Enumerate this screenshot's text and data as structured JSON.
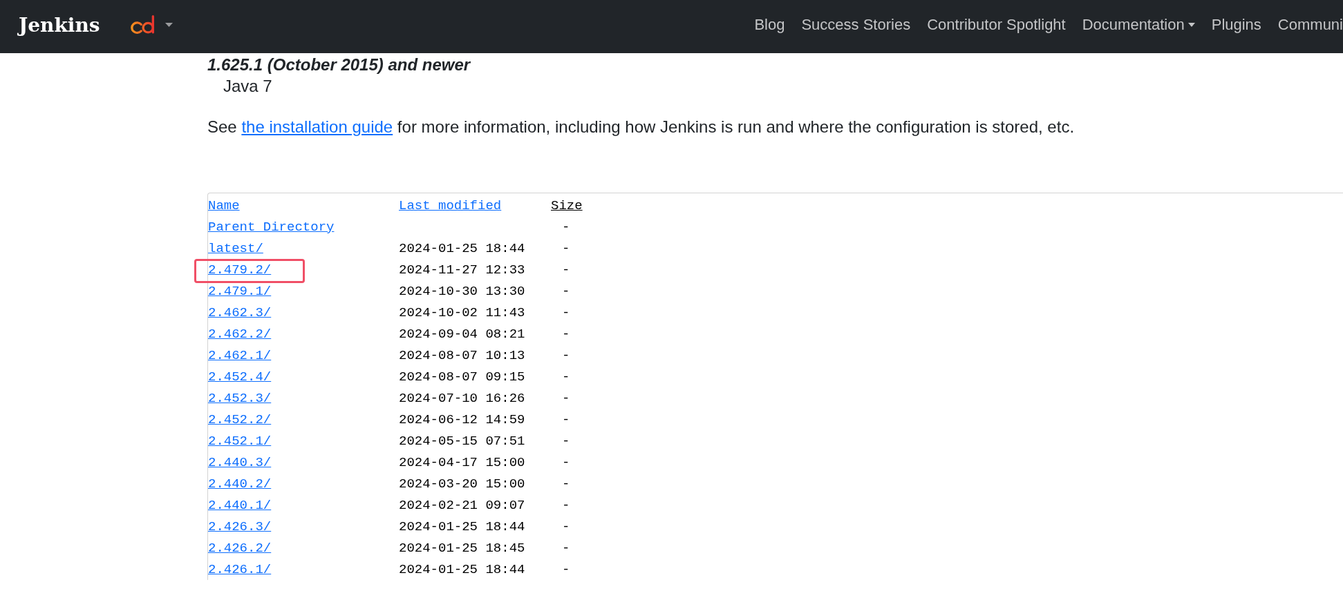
{
  "header": {
    "brand": "Jenkins",
    "nav": [
      {
        "label": "Blog",
        "dropdown": false
      },
      {
        "label": "Success Stories",
        "dropdown": false
      },
      {
        "label": "Contributor Spotlight",
        "dropdown": false
      },
      {
        "label": "Documentation",
        "dropdown": true
      },
      {
        "label": "Plugins",
        "dropdown": false
      },
      {
        "label": "Communi",
        "dropdown": false
      }
    ]
  },
  "requirements": [
    {
      "version": "1.625.1 (October 2015) and newer",
      "java": "Java 7"
    }
  ],
  "install_note": {
    "before": "See ",
    "link": "the installation guide",
    "after": " for more information, including how Jenkins is run and where the configuration is stored, etc."
  },
  "listing": {
    "columns": [
      "Name",
      "Last modified",
      "Size"
    ],
    "rows": [
      {
        "name": "Parent Directory",
        "size": "-",
        "highlighted": false
      },
      {
        "name": "latest/",
        "modified": "2024-01-25 18:44",
        "size": "-",
        "highlighted": false
      },
      {
        "name": "2.479.2/",
        "modified": "2024-11-27 12:33",
        "size": "-",
        "highlighted": true
      },
      {
        "name": "2.479.1/",
        "modified": "2024-10-30 13:30",
        "size": "-",
        "highlighted": false
      },
      {
        "name": "2.462.3/",
        "modified": "2024-10-02 11:43",
        "size": "-",
        "highlighted": false
      },
      {
        "name": "2.462.2/",
        "modified": "2024-09-04 08:21",
        "size": "-",
        "highlighted": false
      },
      {
        "name": "2.462.1/",
        "modified": "2024-08-07 10:13",
        "size": "-",
        "highlighted": false
      },
      {
        "name": "2.452.4/",
        "modified": "2024-08-07 09:15",
        "size": "-",
        "highlighted": false
      },
      {
        "name": "2.452.3/",
        "modified": "2024-07-10 16:26",
        "size": "-",
        "highlighted": false
      },
      {
        "name": "2.452.2/",
        "modified": "2024-06-12 14:59",
        "size": "-",
        "highlighted": false
      },
      {
        "name": "2.452.1/",
        "modified": "2024-05-15 07:51",
        "size": "-",
        "highlighted": false
      },
      {
        "name": "2.440.3/",
        "modified": "2024-04-17 15:00",
        "size": "-",
        "highlighted": false
      },
      {
        "name": "2.440.2/",
        "modified": "2024-03-20 15:00",
        "size": "-",
        "highlighted": false
      },
      {
        "name": "2.440.1/",
        "modified": "2024-02-21 09:07",
        "size": "-",
        "highlighted": false
      },
      {
        "name": "2.426.3/",
        "modified": "2024-01-25 18:44",
        "size": "-",
        "highlighted": false
      },
      {
        "name": "2.426.2/",
        "modified": "2024-01-25 18:45",
        "size": "-",
        "highlighted": false
      },
      {
        "name": "2.426.1/",
        "modified": "2024-01-25 18:44",
        "size": "-",
        "highlighted": false
      }
    ]
  }
}
